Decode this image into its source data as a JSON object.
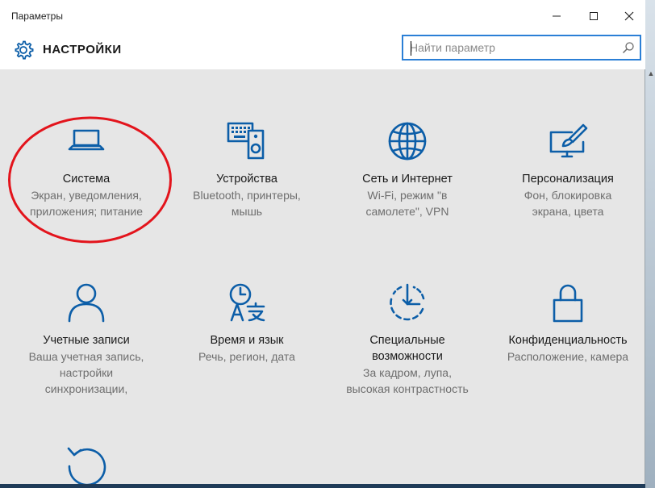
{
  "window": {
    "title": "Параметры",
    "minimize_icon": "minimize-icon",
    "maximize_icon": "maximize-icon",
    "close_icon": "close-icon"
  },
  "header": {
    "title": "НАСТРОЙКИ",
    "icon": "gear-icon"
  },
  "search": {
    "placeholder": "Найти параметр",
    "icon": "search-icon"
  },
  "accent_color": "#0c5ea8",
  "annotation_color": "#e3141c",
  "tiles": [
    {
      "name": "Система",
      "desc1": "Экран, уведомления,",
      "desc2": "приложения; питание",
      "icon": "laptop-icon"
    },
    {
      "name": "Устройства",
      "desc1": "Bluetooth, принтеры,",
      "desc2": "мышь",
      "icon": "devices-icon"
    },
    {
      "name": "Сеть и Интернет",
      "desc1": "Wi-Fi, режим \"в",
      "desc2": "самолете\", VPN",
      "icon": "globe-icon"
    },
    {
      "name": "Персонализация",
      "desc1": "Фон, блокировка",
      "desc2": "экрана, цвета",
      "icon": "personalization-icon"
    },
    {
      "name": "Учетные записи",
      "desc1": "Ваша учетная запись,",
      "desc2": "настройки",
      "desc3": "синхронизации,",
      "icon": "person-icon"
    },
    {
      "name": "Время и язык",
      "desc1": "Речь, регион, дата",
      "icon": "time-language-icon"
    },
    {
      "name": "Специальные",
      "name2": "возможности",
      "desc1": "За кадром, лупа,",
      "desc2": "высокая контрастность",
      "icon": "accessibility-icon"
    },
    {
      "name": "Конфиденциальность",
      "desc1": "Расположение, камера",
      "icon": "lock-icon"
    },
    {
      "icon": "update-icon"
    }
  ]
}
